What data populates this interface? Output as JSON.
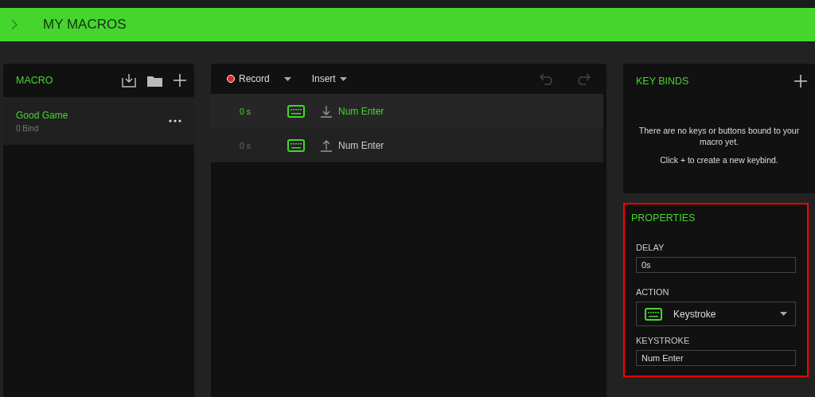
{
  "header": {
    "title": "MY MACROS"
  },
  "macro_panel": {
    "title": "MACRO",
    "items": [
      {
        "name": "Good Game",
        "binds": "0 Bind",
        "selected": true
      }
    ]
  },
  "editor": {
    "record_label": "Record",
    "insert_label": "Insert",
    "rows": [
      {
        "delay": "0 s",
        "kind": "key-down",
        "key": "Num Enter",
        "selected": true
      },
      {
        "delay": "0 s",
        "kind": "key-up",
        "key": "Num Enter",
        "selected": false
      }
    ]
  },
  "key_binds": {
    "title": "KEY BINDS",
    "message": "There are no keys or buttons bound to your macro yet.",
    "hint": "Click + to create a new keybind."
  },
  "properties": {
    "title": "PROPERTIES",
    "highlighted": true,
    "delay_label": "DELAY",
    "delay_value": "0s",
    "action_label": "ACTION",
    "action_value": "Keystroke",
    "keystroke_label": "KEYSTROKE",
    "keystroke_value": "Num Enter"
  }
}
